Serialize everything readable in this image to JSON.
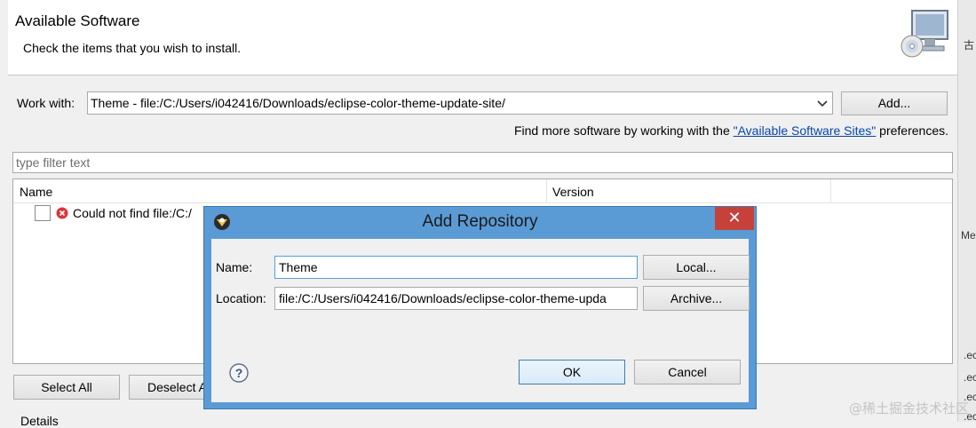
{
  "header": {
    "title": "Available Software",
    "subtitle": "Check the items that you wish to install."
  },
  "work_with": {
    "label": "Work with:",
    "value": "Theme - file:/C:/Users/i042416/Downloads/eclipse-color-theme-update-site/",
    "add_label": "Add..."
  },
  "find_more": {
    "prefix": "Find more software by working with the ",
    "link": "\"Available Software Sites\"",
    "suffix": " preferences."
  },
  "filter": {
    "placeholder": "type filter text"
  },
  "tree": {
    "columns": [
      "Name",
      "Version"
    ],
    "rows": [
      {
        "text": "Could not find file:/C:/",
        "status": "error"
      }
    ]
  },
  "buttons": {
    "select_all": "Select All",
    "deselect_all": "Deselect A"
  },
  "details_label": "Details",
  "dialog": {
    "title": "Add Repository",
    "close_glyph": "✕",
    "name_label": "Name:",
    "name_value": "Theme",
    "location_label": "Location:",
    "location_value": "file:/C:/Users/i042416/Downloads/eclipse-color-theme-upda",
    "local_label": "Local...",
    "archive_label": "Archive...",
    "ok_label": "OK",
    "cancel_label": "Cancel"
  },
  "right_strip": {
    "items": [
      "古",
      "Me",
      ".ec",
      ".ec",
      ".ec",
      ".ec"
    ]
  },
  "watermark": "@稀土掘金技术社区",
  "colors": {
    "dialog_frame": "#5b9bd5",
    "close_button": "#c7413b",
    "link": "#0645ad"
  }
}
